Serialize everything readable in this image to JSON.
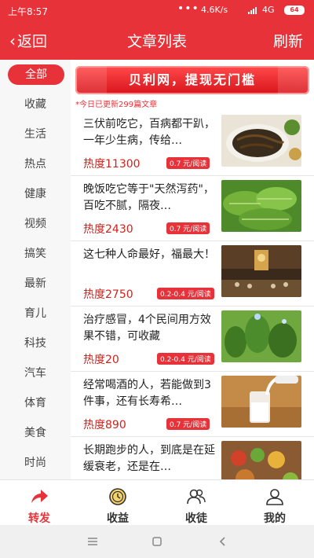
{
  "status": {
    "time": "上午8:57",
    "dots": "•••",
    "speed": "4.6K/s",
    "network": "4G",
    "battery": "64"
  },
  "header": {
    "back_label": "返回",
    "title": "文章列表",
    "refresh_label": "刷新"
  },
  "sidebar": {
    "items": [
      {
        "label": "全部",
        "active": true
      },
      {
        "label": "收藏"
      },
      {
        "label": "生活"
      },
      {
        "label": "热点"
      },
      {
        "label": "健康"
      },
      {
        "label": "视频"
      },
      {
        "label": "搞笑"
      },
      {
        "label": "最新"
      },
      {
        "label": "育儿"
      },
      {
        "label": "科技"
      },
      {
        "label": "汽车"
      },
      {
        "label": "体育"
      },
      {
        "label": "美食"
      },
      {
        "label": "时尚"
      }
    ]
  },
  "banner": {
    "text": "贝利网，提现无门槛"
  },
  "update_note": "*今日已更新299篇文章",
  "articles": [
    {
      "title": "三伏前吃它，百病都干趴，一年少生病，传给…",
      "heat": "热度11300",
      "price": "0.7 元/阅读"
    },
    {
      "title": "晚饭吃它等于\"天然泻药\"，百吃不腻，隔夜…",
      "heat": "热度2430",
      "price": "0.7 元/阅读"
    },
    {
      "title": "这七种人命最好，福最大！",
      "heat": "热度2750",
      "price": "0.2-0.4 元/阅读"
    },
    {
      "title": "治疗感冒，4个民间用方效果不错，可收藏",
      "heat": "热度20",
      "price": "0.2-0.4 元/阅读"
    },
    {
      "title": "经常喝酒的人，若能做到3件事，还有长寿希…",
      "heat": "热度890",
      "price": "0.7 元/阅读"
    },
    {
      "title": "长期跑步的人，到底是在延缓衰老，还是在…",
      "heat": "",
      "price": ""
    }
  ],
  "tabs": [
    {
      "label": "转发",
      "icon": "share-arrow-icon",
      "active": true
    },
    {
      "label": "收益",
      "icon": "coin-clock-icon"
    },
    {
      "label": "收徒",
      "icon": "add-friends-icon"
    },
    {
      "label": "我的",
      "icon": "user-icon"
    }
  ],
  "colors": {
    "accent": "#e8323a",
    "heat_text": "#d0221c"
  }
}
